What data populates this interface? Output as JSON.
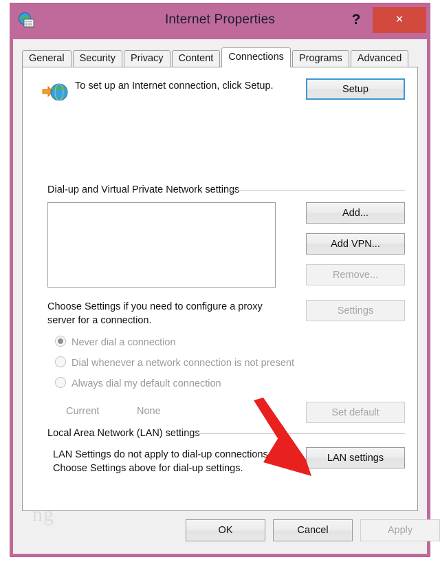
{
  "window": {
    "title": "Internet Properties",
    "icon": "internet-properties-icon",
    "help_label": "?",
    "close_label": "×",
    "accent_titlebar": "#c06a9c",
    "close_button_color": "#d24a3d"
  },
  "tabs": [
    {
      "label": "General",
      "active": false
    },
    {
      "label": "Security",
      "active": false
    },
    {
      "label": "Privacy",
      "active": false
    },
    {
      "label": "Content",
      "active": false
    },
    {
      "label": "Connections",
      "active": true
    },
    {
      "label": "Programs",
      "active": false
    },
    {
      "label": "Advanced",
      "active": false
    }
  ],
  "setup": {
    "icon": "globe-with-arrow-icon",
    "description": "To set up an Internet connection, click Setup.",
    "button_label": "Setup",
    "button_focused": true
  },
  "dialup": {
    "group_label": "Dial-up and Virtual Private Network settings",
    "list_items": [],
    "buttons": [
      {
        "label": "Add...",
        "enabled": true
      },
      {
        "label": "Add VPN...",
        "enabled": true
      },
      {
        "label": "Remove...",
        "enabled": false
      },
      {
        "label": "Settings",
        "enabled": false
      }
    ]
  },
  "proxy": {
    "description": "Choose Settings if you need to configure a proxy server for a connection.",
    "options": [
      {
        "label": "Never dial a connection",
        "selected": true,
        "enabled": false
      },
      {
        "label": "Dial whenever a network connection is not present",
        "selected": false,
        "enabled": false
      },
      {
        "label": "Always dial my default connection",
        "selected": false,
        "enabled": false
      }
    ],
    "current_label": "Current",
    "current_value": "None",
    "set_default_label": "Set default",
    "set_default_enabled": false
  },
  "lan": {
    "group_label": "Local Area Network (LAN) settings",
    "description_line1": "LAN Settings do not apply to dial-up connections.",
    "description_line2": "Choose Settings above for dial-up settings.",
    "button_label": "LAN settings",
    "button_enabled": true
  },
  "footer": {
    "ok_label": "OK",
    "cancel_label": "Cancel",
    "apply_label": "Apply",
    "apply_enabled": false
  },
  "annotation": {
    "arrow_color": "#e8201e",
    "arrow_target": "lan-settings-section"
  },
  "watermark": {
    "text": "ng"
  }
}
